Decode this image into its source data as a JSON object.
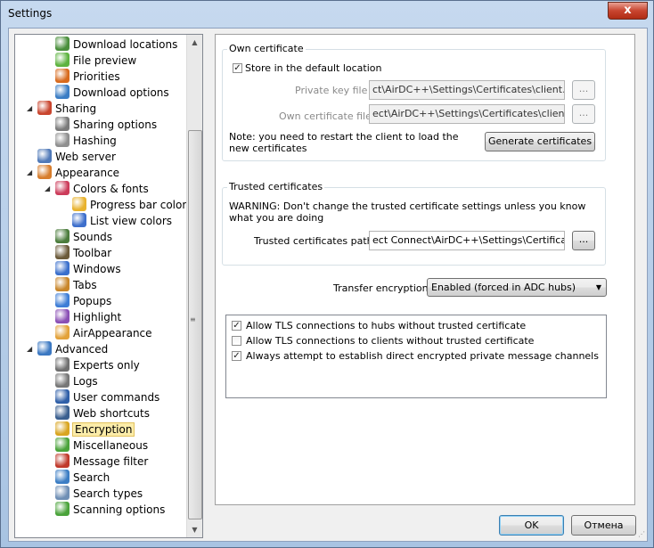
{
  "window": {
    "title": "Settings",
    "close_symbol": "x"
  },
  "tree": {
    "items": [
      {
        "label": "Download locations",
        "level": 2,
        "icon": "folder-download-icon",
        "color": "#4a8f3c"
      },
      {
        "label": "File preview",
        "level": 2,
        "icon": "play-icon",
        "color": "#5db33f"
      },
      {
        "label": "Priorities",
        "level": 2,
        "icon": "priorities-icon",
        "color": "#d86a1d"
      },
      {
        "label": "Download options",
        "level": 2,
        "icon": "download-options-icon",
        "color": "#3b7dc4"
      },
      {
        "label": "Sharing",
        "level": 1,
        "icon": "sharing-icon",
        "color": "#c9452e",
        "expanded": true
      },
      {
        "label": "Sharing options",
        "level": 2,
        "icon": "sharing-options-icon",
        "color": "#7a7a7a"
      },
      {
        "label": "Hashing",
        "level": 2,
        "icon": "hashing-icon",
        "color": "#8f8f8f"
      },
      {
        "label": "Web server",
        "level": 1,
        "icon": "web-server-icon",
        "color": "#4f79b8"
      },
      {
        "label": "Appearance",
        "level": 1,
        "icon": "palette-icon",
        "color": "#d77d2c",
        "expanded": true
      },
      {
        "label": "Colors & fonts",
        "level": 2,
        "icon": "colors-icon",
        "color": "#cc3b5a",
        "expanded": true
      },
      {
        "label": "Progress bar colors",
        "level": 3,
        "icon": "progress-colors-icon",
        "color": "#e8b22e"
      },
      {
        "label": "List view colors",
        "level": 3,
        "icon": "list-colors-icon",
        "color": "#3e6fcc"
      },
      {
        "label": "Sounds",
        "level": 2,
        "icon": "sounds-icon",
        "color": "#4b7c3c"
      },
      {
        "label": "Toolbar",
        "level": 2,
        "icon": "toolbar-icon",
        "color": "#6b5a3a"
      },
      {
        "label": "Windows",
        "level": 2,
        "icon": "windows-icon",
        "color": "#3a6fcc"
      },
      {
        "label": "Tabs",
        "level": 2,
        "icon": "tabs-icon",
        "color": "#c9862a"
      },
      {
        "label": "Popups",
        "level": 2,
        "icon": "popups-icon",
        "color": "#3e7dd6"
      },
      {
        "label": "Highlight",
        "level": 2,
        "icon": "highlight-icon",
        "color": "#8a4fb5"
      },
      {
        "label": "AirAppearance",
        "level": 2,
        "icon": "air-appearance-icon",
        "color": "#e3a23a"
      },
      {
        "label": "Advanced",
        "level": 1,
        "icon": "advanced-icon",
        "color": "#3b78c2",
        "expanded": true
      },
      {
        "label": "Experts only",
        "level": 2,
        "icon": "experts-icon",
        "color": "#6f6f6f"
      },
      {
        "label": "Logs",
        "level": 2,
        "icon": "logs-icon",
        "color": "#777777"
      },
      {
        "label": "User commands",
        "level": 2,
        "icon": "user-commands-icon",
        "color": "#2f5fa8"
      },
      {
        "label": "Web shortcuts",
        "level": 2,
        "icon": "web-shortcuts-icon",
        "color": "#3a5f8f"
      },
      {
        "label": "Encryption",
        "level": 2,
        "icon": "lock-icon",
        "color": "#d9a520",
        "selected": true
      },
      {
        "label": "Miscellaneous",
        "level": 2,
        "icon": "pencil-icon",
        "color": "#4aa33a"
      },
      {
        "label": "Message filter",
        "level": 2,
        "icon": "message-filter-icon",
        "color": "#c0392b"
      },
      {
        "label": "Search",
        "level": 2,
        "icon": "search-icon",
        "color": "#3b7dc4"
      },
      {
        "label": "Search types",
        "level": 2,
        "icon": "search-types-icon",
        "color": "#6f8fb5"
      },
      {
        "label": "Scanning options",
        "level": 2,
        "icon": "scanning-icon",
        "color": "#4aa33a"
      }
    ]
  },
  "own_cert": {
    "title": "Own certificate",
    "store_default_label": "Store in the default location",
    "store_default_checked": true,
    "private_key_label": "Private key file",
    "private_key_value": "ct\\AirDC++\\Settings\\Certificates\\client.key",
    "own_cert_label": "Own certificate file",
    "own_cert_value": "ect\\AirDC++\\Settings\\Certificates\\client.crt",
    "browse_label": "...",
    "note": "Note: you need to restart the client to load the new certificates",
    "generate_label": "Generate certificates"
  },
  "trusted": {
    "title": "Trusted certificates",
    "warning": "WARNING: Don't change the trusted certificate settings unless you know what you are doing",
    "path_label": "Trusted certificates path",
    "path_value": "ect Connect\\AirDC++\\Settings\\Certificates\\",
    "browse_label": "..."
  },
  "transfer": {
    "label": "Transfer encryption",
    "selected": "Enabled (forced in ADC hubs)"
  },
  "options": [
    {
      "label": "Allow TLS connections to hubs without trusted certificate",
      "checked": true
    },
    {
      "label": "Allow TLS connections to clients without trusted certificate",
      "checked": false
    },
    {
      "label": "Always attempt to establish direct encrypted private message channels",
      "checked": true
    }
  ],
  "buttons": {
    "ok": "OK",
    "cancel": "Отмена"
  },
  "colors": {
    "selection": "#fbeca9",
    "title_bg": "#c6d9ef"
  }
}
